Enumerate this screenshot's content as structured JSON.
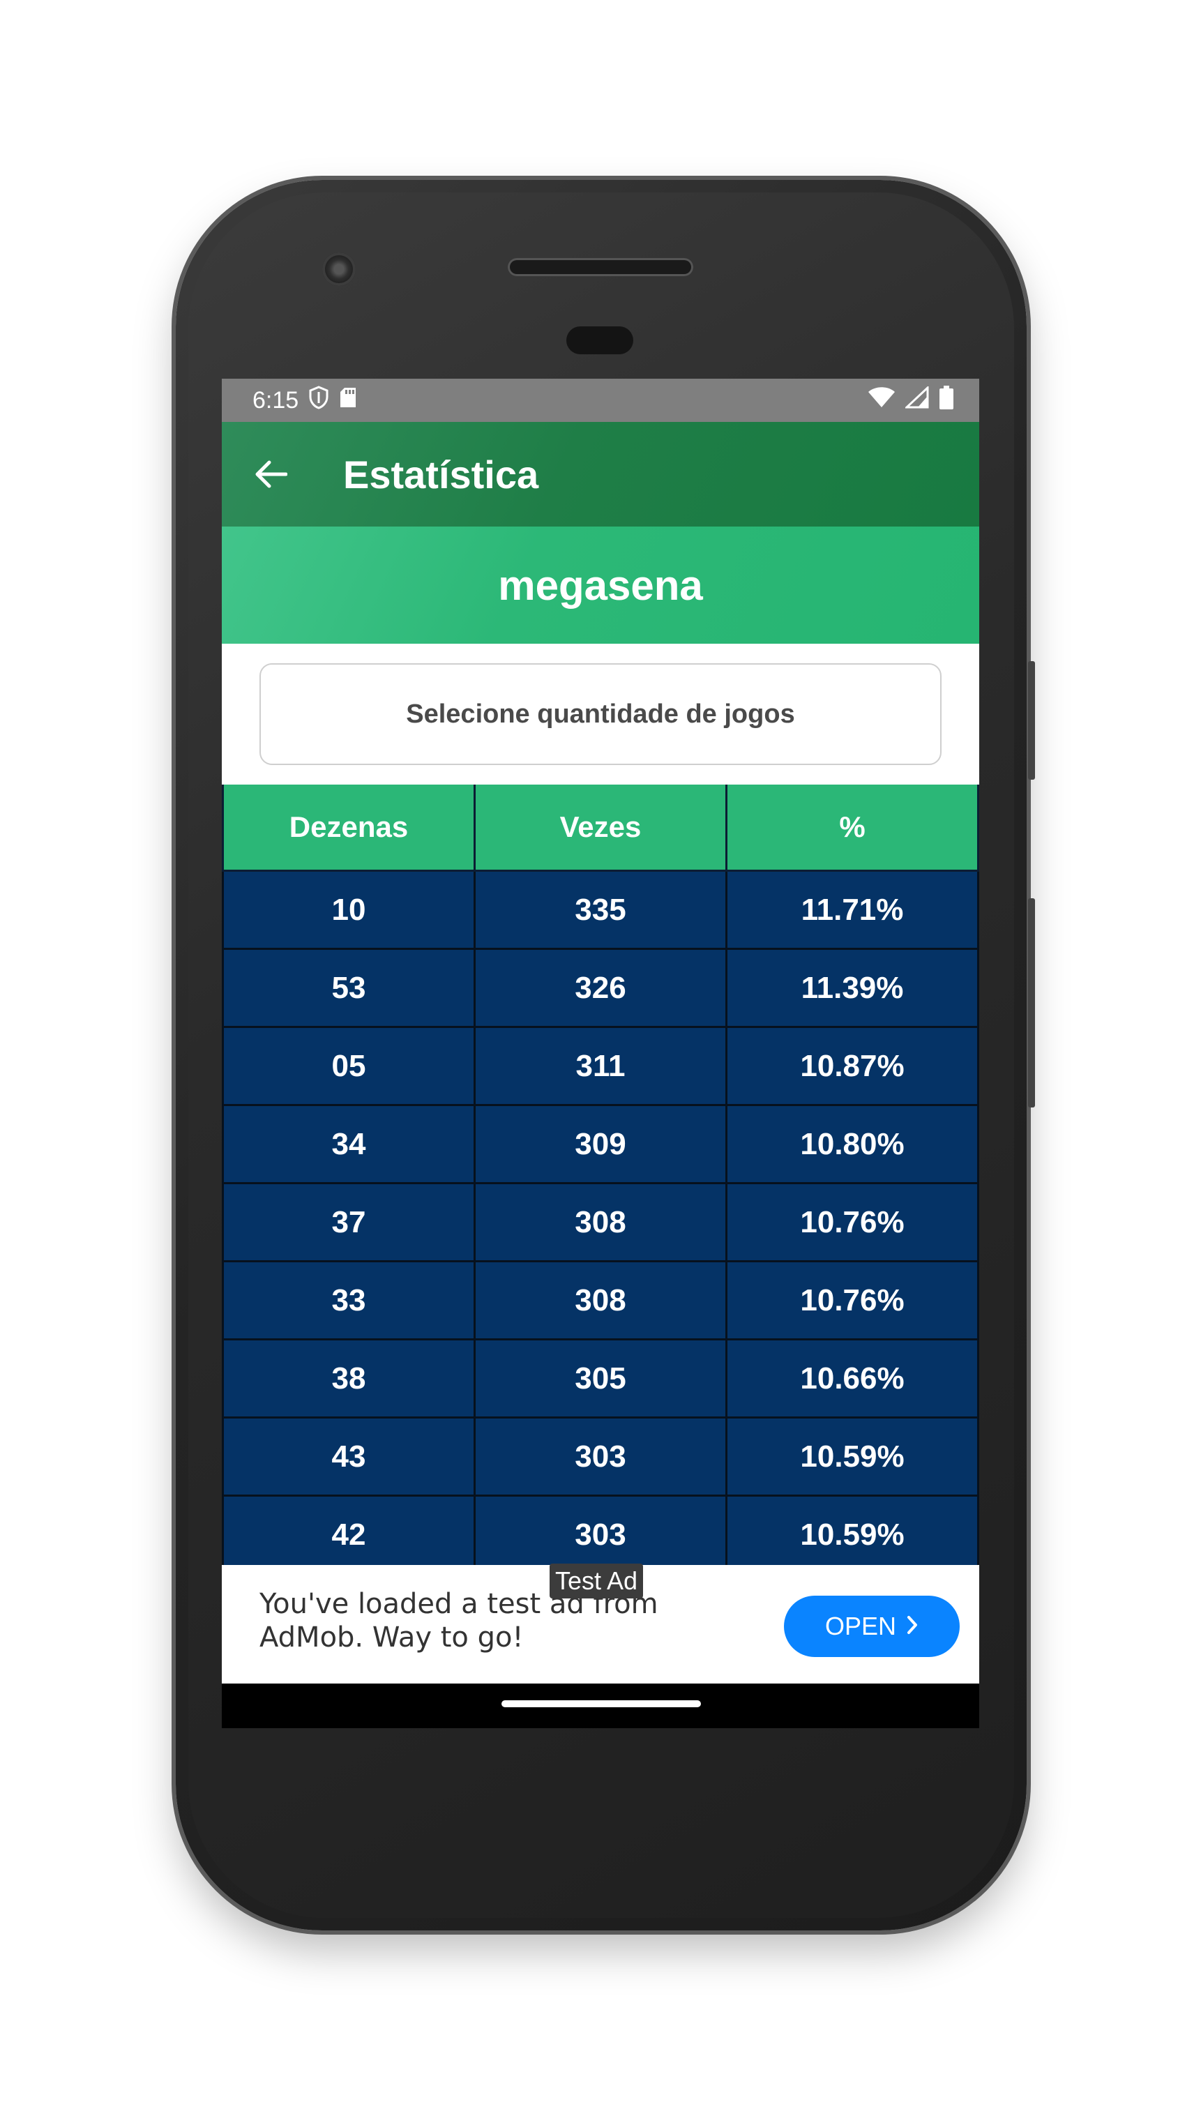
{
  "status_bar": {
    "time": "6:15"
  },
  "app_bar": {
    "title": "Estatística"
  },
  "banner": {
    "title": "megasena"
  },
  "selector": {
    "label": "Selecione quantidade de jogos"
  },
  "table": {
    "headers": [
      "Dezenas",
      "Vezes",
      "%"
    ],
    "rows": [
      [
        "10",
        "335",
        "11.71%"
      ],
      [
        "53",
        "326",
        "11.39%"
      ],
      [
        "05",
        "311",
        "10.87%"
      ],
      [
        "34",
        "309",
        "10.80%"
      ],
      [
        "37",
        "308",
        "10.76%"
      ],
      [
        "33",
        "308",
        "10.76%"
      ],
      [
        "38",
        "305",
        "10.66%"
      ],
      [
        "43",
        "303",
        "10.59%"
      ],
      [
        "42",
        "303",
        "10.59%"
      ]
    ]
  },
  "ad": {
    "label": "Test Ad",
    "text_line1": "You've loaded a test ad from",
    "text_line2": "AdMob. Way to go!",
    "button": "OPEN"
  },
  "colors": {
    "app_bar": "#1f7e47",
    "banner": "#2cb877",
    "header_row": "#2bb777",
    "data_row": "#053366",
    "ad_button": "#0a84ff"
  }
}
